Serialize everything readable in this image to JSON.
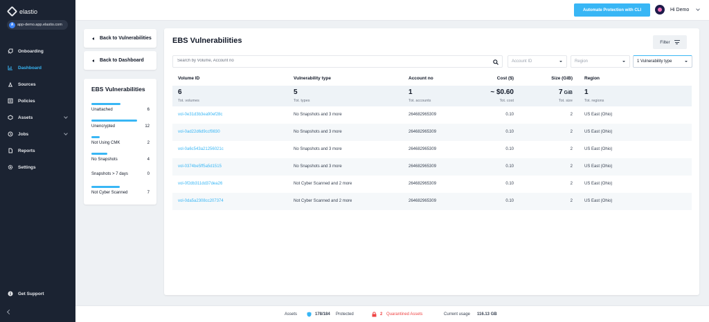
{
  "app": {
    "name": "elastio",
    "tenant": "app-demo.app.elastio.com",
    "tenant_initial": "A"
  },
  "sidebar": {
    "items": [
      {
        "label": "Onboarding",
        "icon": "rocket-icon"
      },
      {
        "label": "Dashboard",
        "icon": "chart-icon",
        "active": true
      },
      {
        "label": "Sources",
        "icon": "sources-icon"
      },
      {
        "label": "Policies",
        "icon": "policies-icon"
      },
      {
        "label": "Assets",
        "icon": "assets-icon",
        "has_children": true
      },
      {
        "label": "Jobs",
        "icon": "clock-icon",
        "has_children": true
      },
      {
        "label": "Reports",
        "icon": "report-icon"
      },
      {
        "label": "Settings",
        "icon": "gear-icon"
      }
    ],
    "support_label": "Get Support"
  },
  "header": {
    "automate_label": "Automate Protection with CLI",
    "user_greeting": "Hi Demo"
  },
  "nav": {
    "back_vuln": "Back to Vulnerabilities",
    "back_dash": "Back to Dashboard"
  },
  "summary": {
    "title": "EBS Vulnerabilities",
    "items": [
      {
        "label": "Unattached",
        "count": "6",
        "fill": 0.5
      },
      {
        "label": "Unencrypted",
        "count": "12",
        "fill": 0.78
      },
      {
        "label": "Not Using CMK",
        "count": "2",
        "fill": 0.14
      },
      {
        "label": "No Snapshots",
        "count": "4",
        "fill": 0.27
      },
      {
        "label": "Snapshots > 7 days",
        "count": "0",
        "fill": 0
      },
      {
        "label": "Not Cyber Scanned",
        "count": "7",
        "fill": 0.49
      }
    ]
  },
  "main": {
    "title": "EBS Vulnerabilities",
    "filter_label": "Filter",
    "search_placeholder": "Search by Volume, Account no",
    "account_placeholder": "Account ID",
    "region_placeholder": "Region",
    "vuln_type_selected": "1 Vulnerability type",
    "columns": [
      "Volume ID",
      "Vulnerability type",
      "Account no",
      "Cost ($)",
      "Size (GiB)",
      "Region"
    ],
    "totals": {
      "volumes": "6",
      "volumes_label": "Tot. volumes",
      "types": "5",
      "types_label": "Tot. types",
      "accounts": "1",
      "accounts_label": "Tot. accounts",
      "cost": "~ $0.60",
      "cost_label": "Tot. cost",
      "size": "7",
      "size_unit": "GiB",
      "size_label": "Tot. size",
      "regions": "1",
      "regions_label": "Tot. regions"
    },
    "rows": [
      {
        "volume": "vol-0e31d3b3ea90ef28c",
        "type": "No Snapshots and 3 more",
        "account": "264682965309",
        "cost": "0.10",
        "size": "2",
        "region": "US East (Ohio)"
      },
      {
        "volume": "vol-0ad22d6d9ccf9830",
        "type": "No Snapshots and 3 more",
        "account": "264682965309",
        "cost": "0.10",
        "size": "2",
        "region": "US East (Ohio)"
      },
      {
        "volume": "vol-0a6c543a21256021c",
        "type": "No Snapshots and 3 more",
        "account": "264682965309",
        "cost": "0.10",
        "size": "2",
        "region": "US East (Ohio)"
      },
      {
        "volume": "vol-0374be5ff5a5d1515",
        "type": "No Snapshots and 3 more",
        "account": "264682965309",
        "cost": "0.10",
        "size": "2",
        "region": "US East (Ohio)"
      },
      {
        "volume": "vol-0f2db311dd37dea26",
        "type": "Not Cyber Scanned and 2 more",
        "account": "264682965309",
        "cost": "0.10",
        "size": "2",
        "region": "US East (Ohio)"
      },
      {
        "volume": "vol-0da5a2308cc207374",
        "type": "Not Cyber Scanned and 2 more",
        "account": "264682965309",
        "cost": "0.10",
        "size": "2",
        "region": "US East (Ohio)"
      }
    ]
  },
  "footer": {
    "assets_label": "Assets",
    "protected_count": "178/184",
    "protected_label": "Protected",
    "quarantined_count": "2",
    "quarantined_label": "Quarantined Assets",
    "usage_label": "Current usage",
    "usage_value": "116.13 GB"
  },
  "colors": {
    "accent": "#38b6f5",
    "sidebar_bg": "#1b2332",
    "danger": "#ef4444"
  }
}
